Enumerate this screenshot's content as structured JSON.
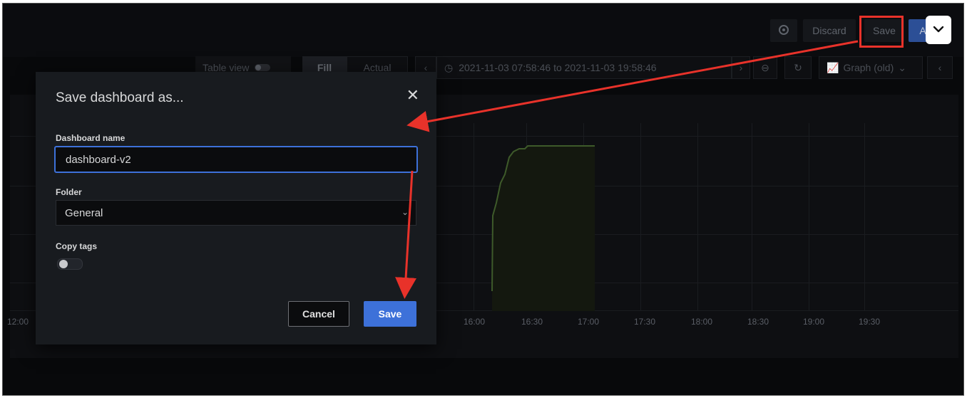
{
  "topbar": {
    "gear_icon": "gear-icon",
    "discard_label": "Discard",
    "save_label": "Save",
    "apply_label": "A",
    "chevron_icon": "chevron-down-icon"
  },
  "toolbar": {
    "table_view_label": "Table view",
    "fill_label": "Fill",
    "actual_label": "Actual",
    "time_range": "2021-11-03 07:58:46 to 2021-11-03 19:58:46",
    "visualization_label": "Graph (old)"
  },
  "graph": {
    "x_ticks": [
      "12:00",
      "16:00",
      "16:30",
      "17:00",
      "17:30",
      "18:00",
      "18:30",
      "19:00",
      "19:30"
    ]
  },
  "modal": {
    "title": "Save dashboard as...",
    "name_label": "Dashboard name",
    "name_value": "dashboard-v2",
    "folder_label": "Folder",
    "folder_value": "General",
    "copy_tags_label": "Copy tags",
    "copy_tags_enabled": false,
    "cancel_label": "Cancel",
    "save_label": "Save"
  },
  "colors": {
    "accent": "#3d71d9",
    "annotation": "#e8322a",
    "background": "#08090b",
    "modal": "#181b1f"
  }
}
